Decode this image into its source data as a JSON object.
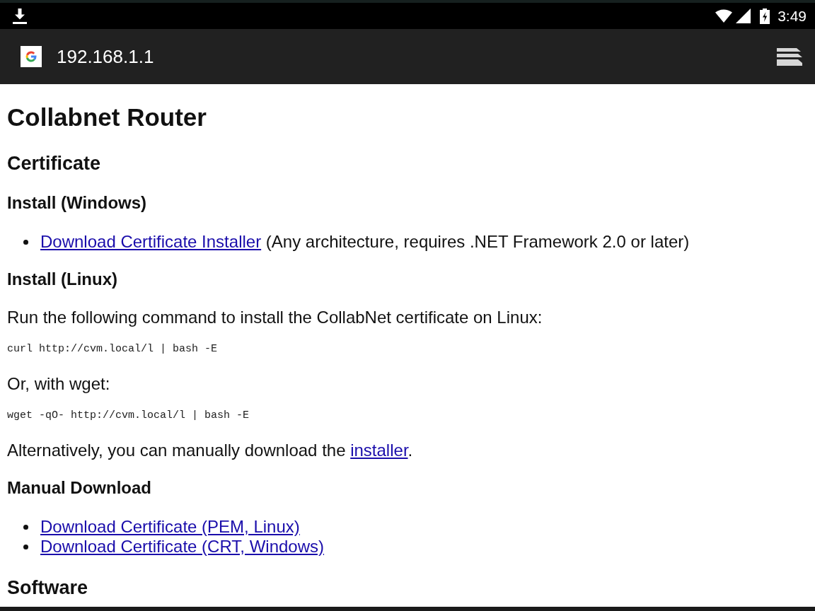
{
  "status_bar": {
    "time": "3:49"
  },
  "toolbar": {
    "url": "192.168.1.1"
  },
  "page": {
    "blocks": [
      {
        "kind": "title",
        "text": "Collabnet Router"
      },
      {
        "kind": "section",
        "text": "Certificate"
      },
      {
        "kind": "subsection",
        "text": "Install (Windows)"
      },
      {
        "kind": "list",
        "items": [
          {
            "parts": [
              {
                "kind": "link",
                "text": "Download Certificate Installer"
              },
              {
                "kind": "text",
                "text": " (Any architecture, requires .NET Framework 2.0 or later)"
              }
            ]
          }
        ]
      },
      {
        "kind": "subsection",
        "text": "Install (Linux)"
      },
      {
        "kind": "paragraph",
        "parts": [
          {
            "kind": "text",
            "text": "Run the following command to install the CollabNet certificate on Linux:"
          }
        ]
      },
      {
        "kind": "code",
        "text": "curl http://cvm.local/l | bash -E"
      },
      {
        "kind": "paragraph",
        "parts": [
          {
            "kind": "text",
            "text": "Or, with wget:"
          }
        ]
      },
      {
        "kind": "code",
        "text": "wget -qO- http://cvm.local/l | bash -E"
      },
      {
        "kind": "paragraph",
        "parts": [
          {
            "kind": "text",
            "text": "Alternatively, you can manually download the "
          },
          {
            "kind": "link",
            "text": "installer"
          },
          {
            "kind": "text",
            "text": "."
          }
        ]
      },
      {
        "kind": "subsection",
        "text": "Manual Download"
      },
      {
        "kind": "list",
        "items": [
          {
            "parts": [
              {
                "kind": "link",
                "text": "Download Certificate (PEM, Linux)"
              }
            ]
          },
          {
            "parts": [
              {
                "kind": "link",
                "text": "Download Certificate (CRT, Windows)"
              }
            ]
          }
        ]
      },
      {
        "kind": "section",
        "text": "Software"
      }
    ]
  }
}
